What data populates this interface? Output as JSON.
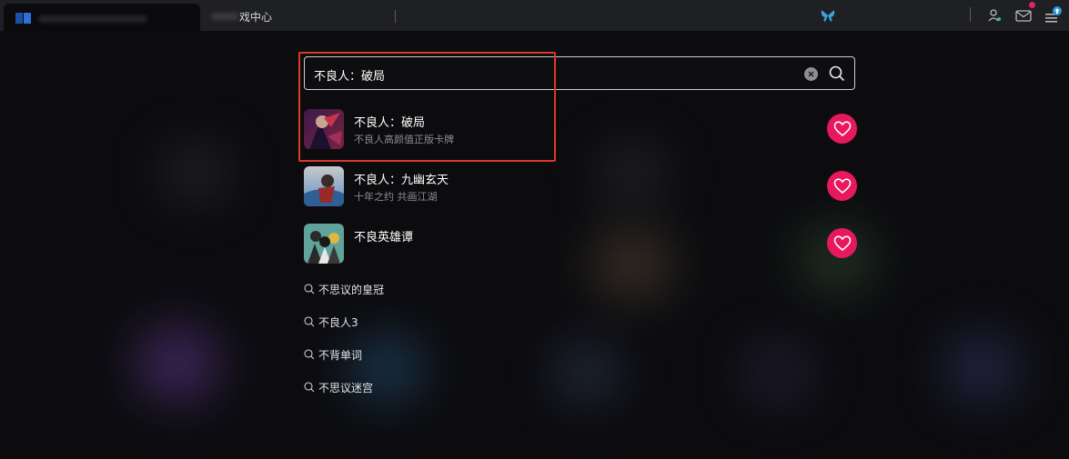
{
  "topbar": {
    "tab_label": "戏中心",
    "icons": [
      "app-logo-icon",
      "butterfly-icon",
      "user-icon",
      "mail-icon",
      "menu-icon"
    ],
    "accent": "#2c9bd6",
    "notification_color": "#e0245e"
  },
  "search": {
    "value": "不良人：破局"
  },
  "results": [
    {
      "title": "不良人：破局",
      "subtitle": "不良人高颜值正版卡牌"
    },
    {
      "title": "不良人：九幽玄天",
      "subtitle": "十年之约 共画江湖"
    },
    {
      "title": "不良英雄谭",
      "subtitle": ""
    }
  ],
  "suggestions": [
    "不思议的皇冠",
    "不良人3",
    "不背单词",
    "不思议迷宫"
  ],
  "colors": {
    "favorite_button": "#e8185f",
    "highlight_box": "#d93a2c"
  }
}
